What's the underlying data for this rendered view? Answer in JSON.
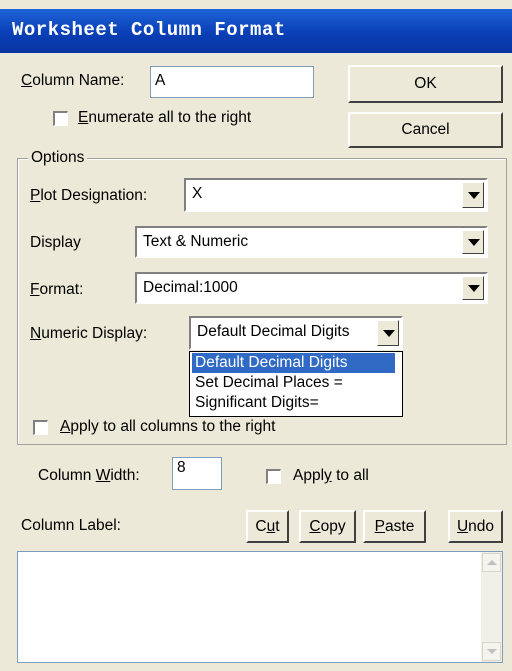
{
  "window": {
    "title": "Worksheet Column Format"
  },
  "column_name": {
    "label": "Column Name:",
    "value": "A"
  },
  "enumerate": {
    "label": "Enumerate all to the right",
    "checked": false
  },
  "buttons": {
    "ok": "OK",
    "cancel": "Cancel"
  },
  "options": {
    "group_label": "Options",
    "plot_designation": {
      "label": "Plot Designation:",
      "value": "X"
    },
    "display": {
      "label": "Display",
      "value": "Text & Numeric"
    },
    "format": {
      "label": "Format:",
      "value": "Decimal:1000"
    },
    "numeric_display": {
      "label": "Numeric Display:",
      "value": "Default Decimal Digits",
      "options": [
        "Default Decimal Digits",
        "Set Decimal Places =",
        "Significant Digits="
      ]
    },
    "apply_all_right": {
      "label": "Apply to all columns to the right",
      "checked": false
    }
  },
  "column_width": {
    "label": "Column Width:",
    "value": "8"
  },
  "apply_to_all": {
    "label": "Apply to all",
    "checked": false
  },
  "column_label": {
    "label": "Column Label:",
    "buttons": {
      "cut": "Cut",
      "copy": "Copy",
      "paste": "Paste",
      "undo": "Undo"
    },
    "value": ""
  }
}
